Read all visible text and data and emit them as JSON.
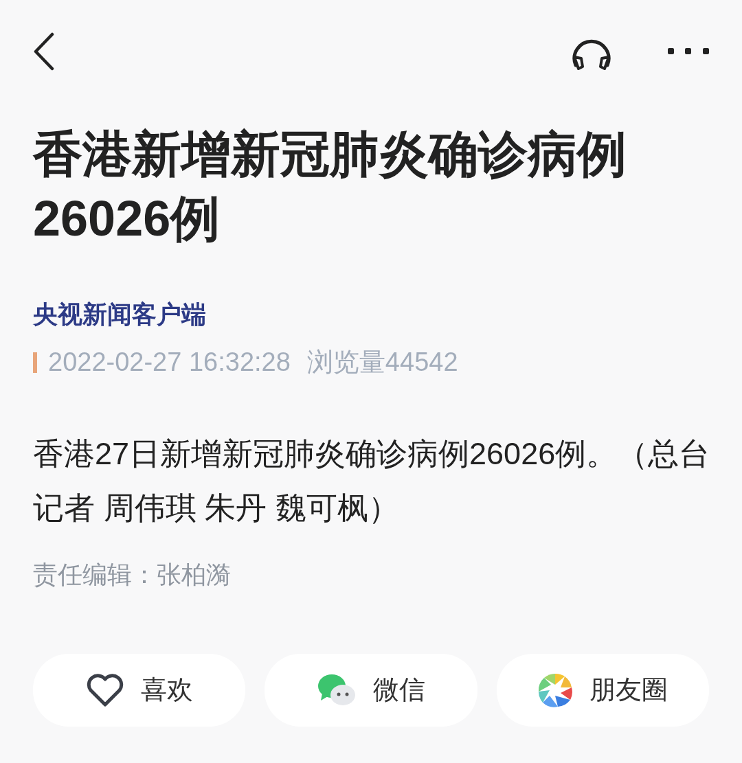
{
  "title": "香港新增新冠肺炎确诊病例26026例",
  "source": "央视新闻客户端",
  "meta": {
    "datetime": "2022-02-27 16:32:28",
    "views": "浏览量44542"
  },
  "body": "香港27日新增新冠肺炎确诊病例26026例。（总台记者 周伟琪 朱丹 魏可枫）",
  "editor": "责任编辑：张柏漪",
  "actions": [
    {
      "kind": "like",
      "label": "喜欢"
    },
    {
      "kind": "wechat",
      "label": "微信"
    },
    {
      "kind": "moments",
      "label": "朋友圈"
    }
  ]
}
